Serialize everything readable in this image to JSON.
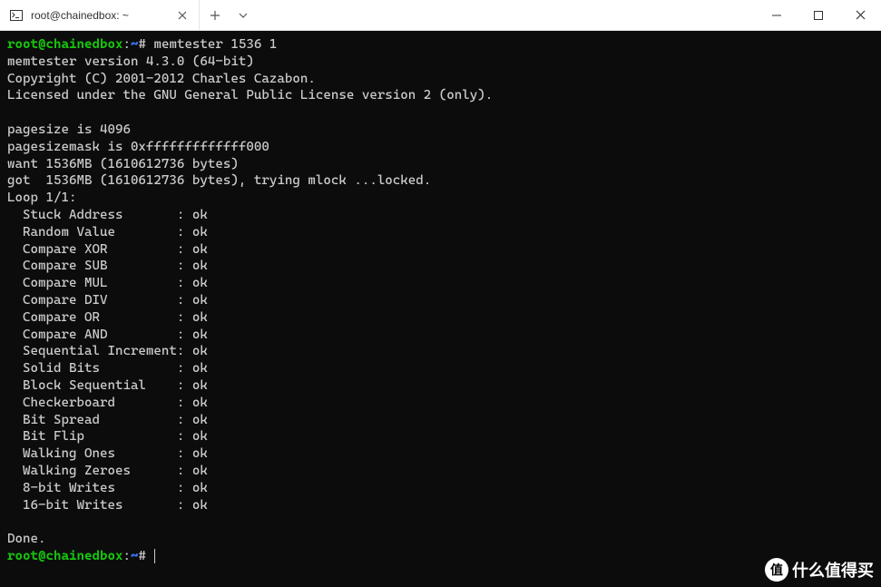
{
  "tab": {
    "title": "root@chainedbox: ~"
  },
  "prompt": {
    "user_host": "root@chainedbox",
    "path": "~",
    "symbol": "#"
  },
  "command": "memtester 1536 1",
  "header": {
    "version_line": "memtester version 4.3.0 (64-bit)",
    "copyright_line": "Copyright (C) 2001-2012 Charles Cazabon.",
    "license_line": "Licensed under the GNU General Public License version 2 (only)."
  },
  "info": {
    "pagesize": "pagesize is 4096",
    "pagesizemask": "pagesizemask is 0xfffffffffffff000",
    "want": "want 1536MB (1610612736 bytes)",
    "got": "got  1536MB (1610612736 bytes), trying mlock ...locked."
  },
  "loop_label": "Loop 1/1:",
  "tests": [
    {
      "name": "Stuck Address",
      "result": "ok"
    },
    {
      "name": "Random Value",
      "result": "ok"
    },
    {
      "name": "Compare XOR",
      "result": "ok"
    },
    {
      "name": "Compare SUB",
      "result": "ok"
    },
    {
      "name": "Compare MUL",
      "result": "ok"
    },
    {
      "name": "Compare DIV",
      "result": "ok"
    },
    {
      "name": "Compare OR",
      "result": "ok"
    },
    {
      "name": "Compare AND",
      "result": "ok"
    },
    {
      "name": "Sequential Increment",
      "result": "ok"
    },
    {
      "name": "Solid Bits",
      "result": "ok"
    },
    {
      "name": "Block Sequential",
      "result": "ok"
    },
    {
      "name": "Checkerboard",
      "result": "ok"
    },
    {
      "name": "Bit Spread",
      "result": "ok"
    },
    {
      "name": "Bit Flip",
      "result": "ok"
    },
    {
      "name": "Walking Ones",
      "result": "ok"
    },
    {
      "name": "Walking Zeroes",
      "result": "ok"
    },
    {
      "name": "8-bit Writes",
      "result": "ok"
    },
    {
      "name": "16-bit Writes",
      "result": "ok"
    }
  ],
  "done": "Done.",
  "watermark": {
    "badge": "值",
    "text": "什么值得买"
  }
}
